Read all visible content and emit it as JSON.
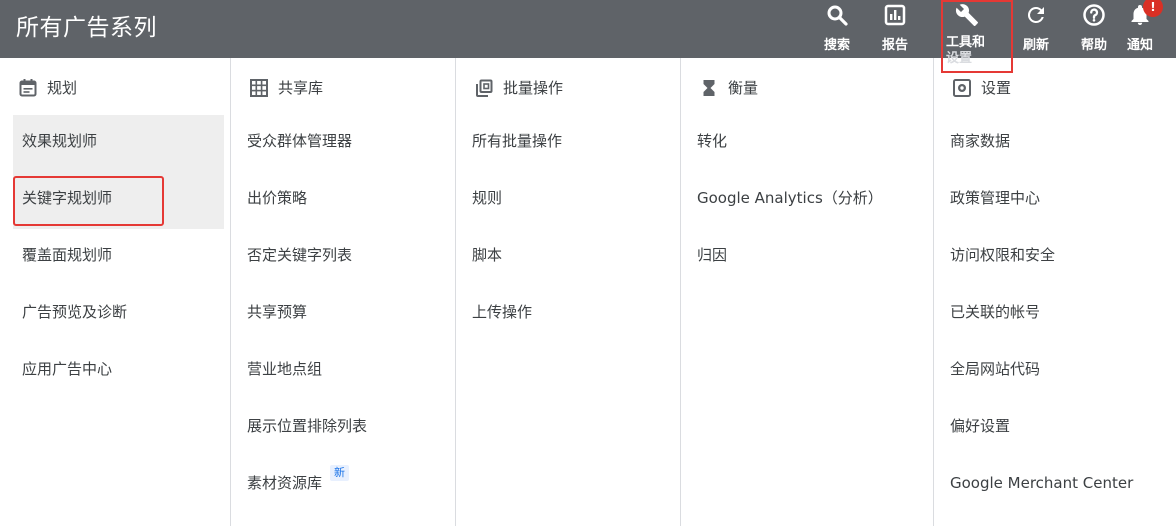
{
  "app": {
    "title": "所有广告系列"
  },
  "toolbar": {
    "search": {
      "label": "搜索",
      "icon": "search-icon"
    },
    "reports": {
      "label": "报告",
      "icon": "bar-chart-icon"
    },
    "tools": {
      "label": "工具和",
      "label_line2": "设置",
      "icon": "wrench-icon"
    },
    "refresh": {
      "label": "刷新",
      "icon": "refresh-icon"
    },
    "help": {
      "label": "帮助",
      "icon": "help-icon"
    },
    "notifications": {
      "label": "通知",
      "icon": "bell-icon",
      "badge": "!"
    }
  },
  "columns": [
    {
      "heading": "规划",
      "icon": "calendar-icon",
      "items": [
        "效果规划师",
        "关键字规划师",
        "覆盖面规划师",
        "广告预览及诊断",
        "应用广告中心"
      ]
    },
    {
      "heading": "共享库",
      "icon": "grid-icon",
      "items": [
        "受众群体管理器",
        "出价策略",
        "否定关键字列表",
        "共享预算",
        "营业地点组",
        "展示位置排除列表",
        "素材资源库"
      ],
      "new_label": "新"
    },
    {
      "heading": "批量操作",
      "icon": "copy-icon",
      "items": [
        "所有批量操作",
        "规则",
        "脚本",
        "上传操作"
      ]
    },
    {
      "heading": "衡量",
      "icon": "hourglass-icon",
      "items": [
        "转化",
        "Google Analytics（分析）",
        "归因"
      ]
    },
    {
      "heading": "设置",
      "icon": "settings-icon",
      "items": [
        "商家数据",
        "政策管理中心",
        "访问权限和安全",
        "已关联的帐号",
        "全局网站代码",
        "偏好设置",
        "Google Merchant Center"
      ]
    }
  ],
  "colors": {
    "topbar": "#5f6368",
    "highlight_border": "#e53935",
    "shaded_row": "#eeeeee",
    "badge": "#d93025"
  }
}
